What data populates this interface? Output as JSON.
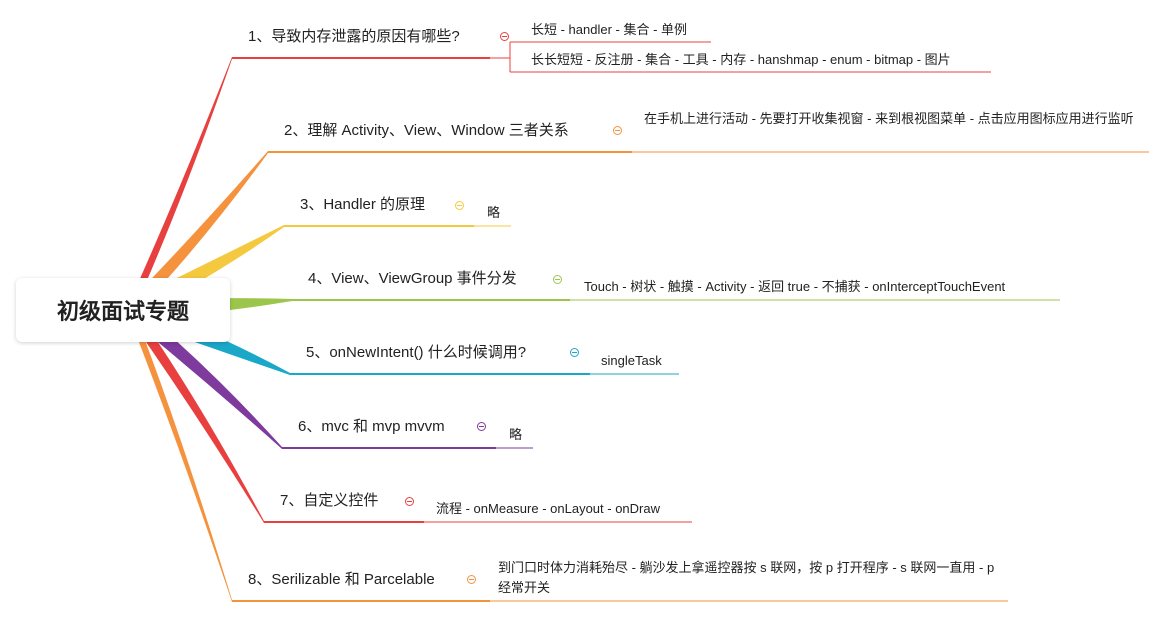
{
  "root": {
    "title": "初级面试专题"
  },
  "colors": {
    "red": "#e8403f",
    "orange": "#f5923e",
    "yellow": "#f5c93f",
    "green": "#9cc64b",
    "cyan": "#1aa8c9",
    "purple": "#7e3a9c"
  },
  "topics": [
    {
      "label": "1、导致内存泄露的原因有哪些?",
      "color": "red",
      "leaves": [
        "长短 - handler - 集合 - 单例",
        "长长短短 - 反注册 - 集合 - 工具 - 内存 - hanshmap - enum - bitmap - 图片"
      ]
    },
    {
      "label": "2、理解 Activity、View、Window 三者关系",
      "color": "orange",
      "leaves": [
        "在手机上进行活动 - 先要打开收集视窗 - 来到根视图菜单 - 点击应用图标应用进行监听"
      ]
    },
    {
      "label": "3、Handler 的原理",
      "color": "yellow",
      "leaves": [
        "略"
      ]
    },
    {
      "label": "4、View、ViewGroup 事件分发",
      "color": "green",
      "leaves": [
        "Touch - 树状 - 触摸 - Activity - 返回 true - 不捕获 - onInterceptTouchEvent"
      ]
    },
    {
      "label": "5、onNewIntent() 什么时候调用?",
      "color": "cyan",
      "leaves": [
        "singleTask"
      ]
    },
    {
      "label": "6、mvc 和 mvp mvvm",
      "color": "purple",
      "leaves": [
        "略"
      ]
    },
    {
      "label": "7、自定义控件",
      "color": "red",
      "leaves": [
        "流程 - onMeasure - onLayout - onDraw"
      ]
    },
    {
      "label": "8、Serilizable 和 Parcelable",
      "color": "orange",
      "leaves": [
        "到门口时体力消耗殆尽 - 躺沙发上拿遥控器按 s 联网，按 p 打开程序 - s 联网一直用 - p 经常开关"
      ]
    }
  ]
}
